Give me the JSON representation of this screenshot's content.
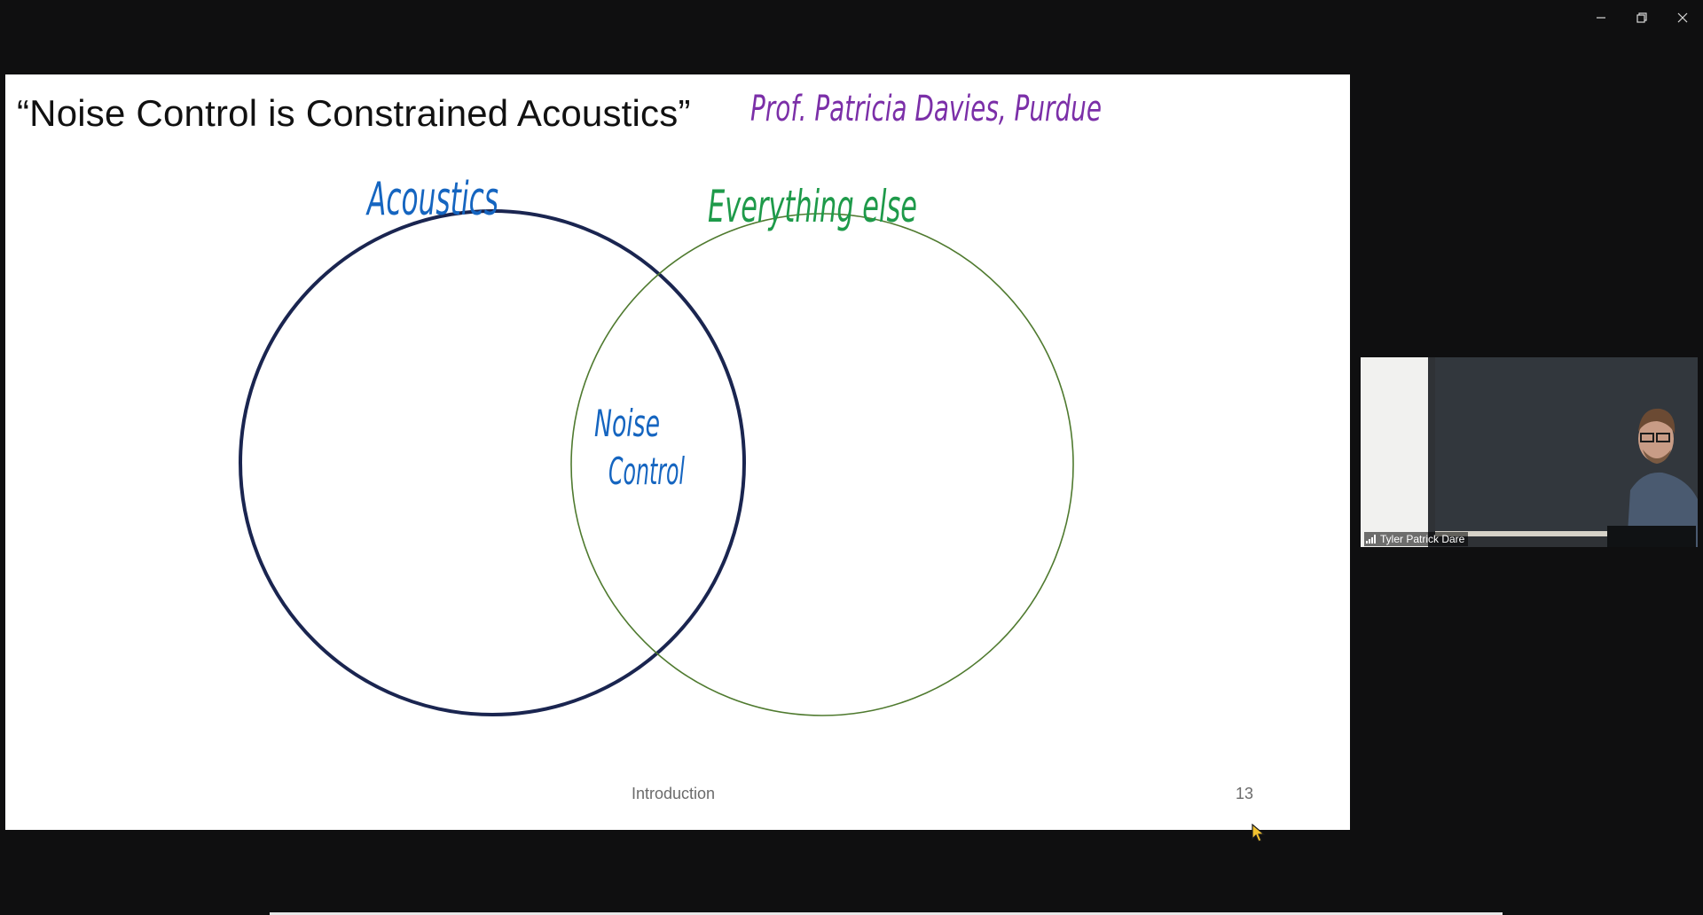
{
  "window": {
    "controls": {
      "minimize_icon": "minimize-icon",
      "restore_icon": "restore-icon",
      "close_icon": "close-icon"
    }
  },
  "slide": {
    "title": "“Noise Control is Constrained Acoustics”",
    "attribution": "Prof. Patricia Davies, Purdue",
    "attribution_color": "#7b2fa8",
    "venn": {
      "left_label": "Acoustics",
      "left_label_color": "#1565c0",
      "left_circle_color": "#1a2550",
      "right_label": "Everything else",
      "right_label_color": "#1e9a4a",
      "right_circle_color": "#4f7a2f",
      "overlap_label_line1": "Noise",
      "overlap_label_line2": "Control",
      "overlap_label_color": "#1565c0"
    },
    "footer": "Introduction",
    "page_number": "13"
  },
  "participant": {
    "name": "Tyler Patrick Dare",
    "signal_icon": "signal-bars-icon"
  },
  "cursor_icon": "pointer-cursor-icon"
}
